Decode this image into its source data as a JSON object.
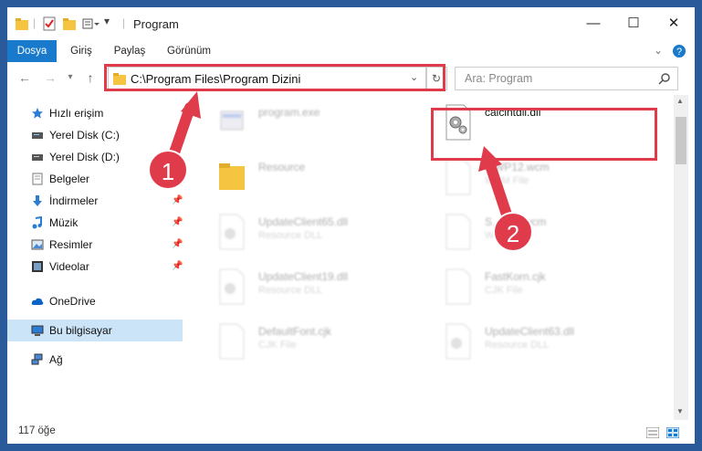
{
  "window": {
    "title": "Program"
  },
  "ribbon": {
    "tabs": [
      "Dosya",
      "Giriş",
      "Paylaş",
      "Görünüm"
    ]
  },
  "address": {
    "path": "C:\\Program Files\\Program Dizini"
  },
  "search": {
    "placeholder": "Ara: Program"
  },
  "sidebar": {
    "items": [
      {
        "label": "Hızlı erişim",
        "icon": "star-icon",
        "pinned": false
      },
      {
        "label": "Yerel Disk (C:)",
        "icon": "drive-icon",
        "pinned": false
      },
      {
        "label": "Yerel Disk (D:)",
        "icon": "drive-icon",
        "pinned": false
      },
      {
        "label": "Belgeler",
        "icon": "document-icon",
        "pinned": false
      },
      {
        "label": "İndirmeler",
        "icon": "download-icon",
        "pinned": true
      },
      {
        "label": "Müzik",
        "icon": "music-icon",
        "pinned": true
      },
      {
        "label": "Resimler",
        "icon": "pictures-icon",
        "pinned": true
      },
      {
        "label": "Videolar",
        "icon": "video-icon",
        "pinned": true
      },
      {
        "label": "OneDrive",
        "icon": "cloud-icon",
        "pinned": false
      },
      {
        "label": "Bu bilgisayar",
        "icon": "computer-icon",
        "pinned": false
      },
      {
        "label": "Ağ",
        "icon": "network-icon",
        "pinned": false
      }
    ]
  },
  "files": [
    {
      "name": "program.exe",
      "type": "",
      "icon": "exe-icon"
    },
    {
      "name": "calcintdll.dll",
      "type": "",
      "icon": "dll-icon"
    },
    {
      "name": "Resource",
      "type": "",
      "icon": "folder-icon"
    },
    {
      "name": "...WP12.wcm",
      "type": "WCM File",
      "icon": "file-icon"
    },
    {
      "name": "UpdateClient65.dll",
      "type": "Resource DLL",
      "icon": "dll-icon"
    },
    {
      "name": "S...P15.wcm",
      "type": "W...",
      "icon": "file-icon"
    },
    {
      "name": "UpdateClient19.dll",
      "type": "Resource DLL",
      "icon": "dll-icon"
    },
    {
      "name": "FastKorn.cjk",
      "type": "CJK File",
      "icon": "file-icon"
    },
    {
      "name": "DefaultFont.cjk",
      "type": "CJK File",
      "icon": "file-icon"
    },
    {
      "name": "UpdateClient63.dll",
      "type": "Resource DLL",
      "icon": "dll-icon"
    }
  ],
  "status": {
    "count": "117 öğe"
  },
  "annotations": {
    "step1": "1",
    "step2": "2",
    "color": "#e03b4a"
  }
}
